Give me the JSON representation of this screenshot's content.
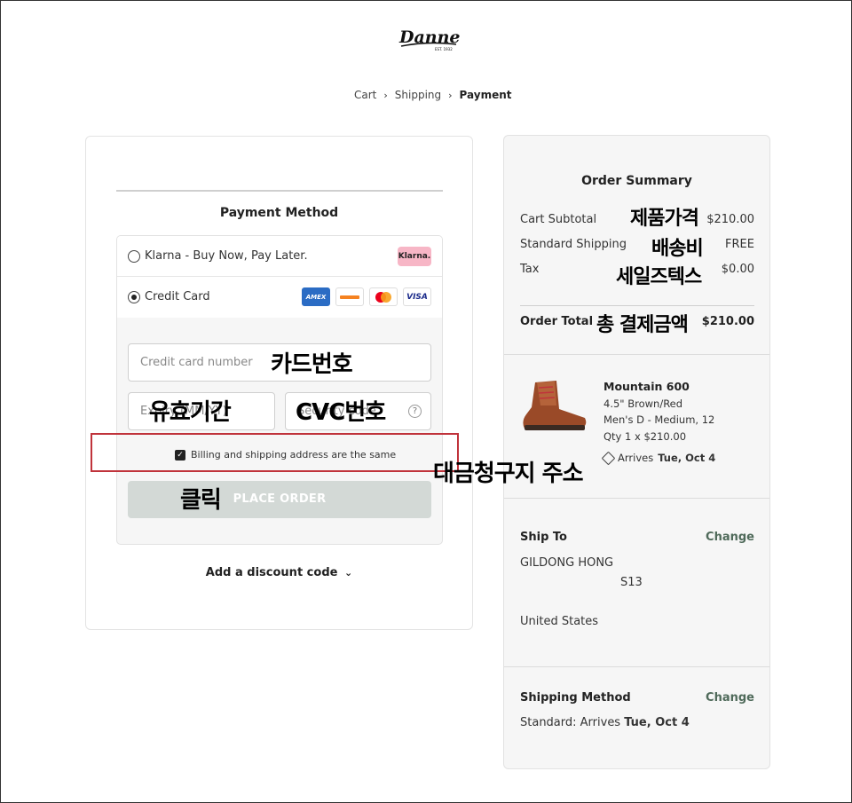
{
  "brand": {
    "logo_text": "Danner",
    "logo_sub": "EST. 1932"
  },
  "breadcrumb": {
    "cart": "Cart",
    "shipping": "Shipping",
    "payment": "Payment"
  },
  "payment": {
    "title": "Payment Method",
    "klarna_label": "Klarna - Buy Now, Pay Later.",
    "klarna_badge": "Klarna.",
    "credit_label": "Credit Card",
    "card_brands": [
      "AMEX",
      "DISCOVER",
      "MASTERCARD",
      "VISA"
    ],
    "card_number_placeholder": "Credit card number",
    "expiry_placeholder": "Expiry (MM/YY)",
    "cvc_placeholder": "Security code",
    "billing_same_label": "Billing and shipping address are the same",
    "billing_same_checked": true,
    "place_order": "PLACE ORDER",
    "discount_link": "Add a discount code"
  },
  "annotations": {
    "card_number": "카드번호",
    "expiry": "유효기간",
    "cvc": "CVC번호",
    "billing": "대금청구지 주소",
    "click": "클릭",
    "subtotal": "제품가격",
    "shipping": "배송비",
    "tax": "세일즈텍스",
    "total": "총 결제금액",
    "accent_color": "#c0333b"
  },
  "summary": {
    "title": "Order Summary",
    "subtotal_label": "Cart Subtotal",
    "subtotal_value": "$210.00",
    "shipping_label": "Standard Shipping",
    "shipping_value": "FREE",
    "tax_label": "Tax",
    "tax_value": "$0.00",
    "total_label": "Order Total",
    "total_value": "$210.00"
  },
  "product": {
    "name": "Mountain 600",
    "variant": "4.5\" Brown/Red",
    "size": "Men's D - Medium, 12",
    "qty": "Qty 1 x $210.00",
    "arrives_prefix": "Arrives",
    "arrives_date": "Tue, Oct 4"
  },
  "ship_to": {
    "title": "Ship To",
    "change": "Change",
    "name": "GILDONG HONG",
    "line2": "S13",
    "country": "United States"
  },
  "shipping_method": {
    "title": "Shipping Method",
    "change": "Change",
    "value_prefix": "Standard: Arrives",
    "value_date": "Tue, Oct 4"
  },
  "colors": {
    "button_disabled": "#d3d9d6",
    "link_green": "#4f6a5a",
    "klarna_pink": "#f7b6c6"
  }
}
